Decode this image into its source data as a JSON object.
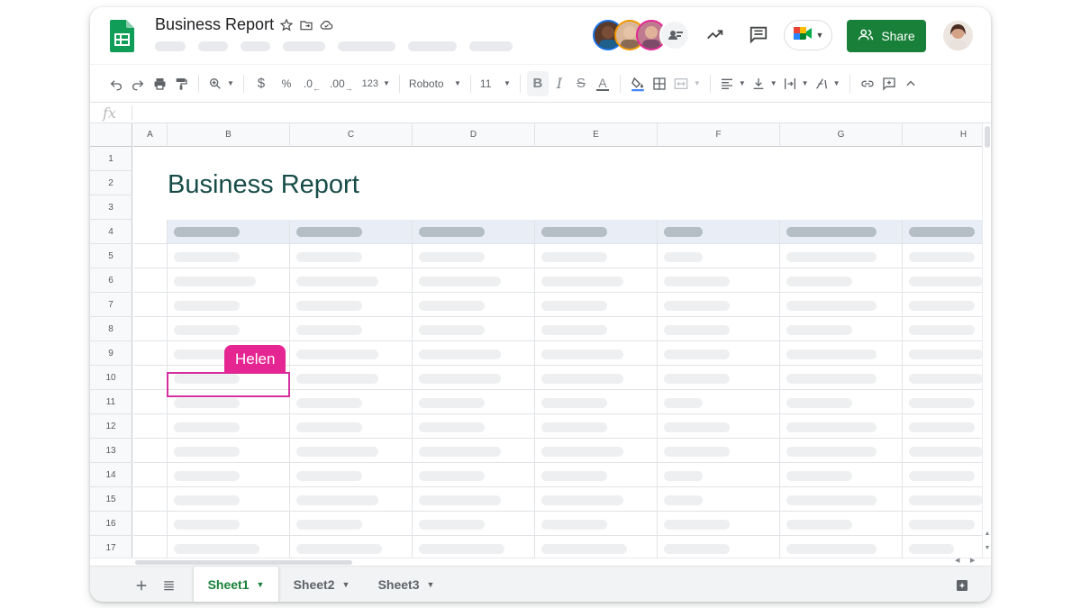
{
  "app": {
    "title": "Business Report"
  },
  "menu": {
    "items_count_visual": [
      "",
      "",
      "",
      "",
      "",
      "",
      ""
    ]
  },
  "toolbar": {
    "currency_label": "$",
    "percent_label": "%",
    "decrease_decimal_label": ".0",
    "increase_decimal_label": ".00",
    "number_format_label": "123",
    "font_family": "Roboto",
    "font_size": "11",
    "bold_label": "B",
    "italic_label": "I",
    "strikethrough_label": "S",
    "text_color_label": "A"
  },
  "formula_bar": {
    "fx_label": "fx",
    "value": ""
  },
  "sheet": {
    "title_cell": "Business Report",
    "columns": [
      "A",
      "B",
      "C",
      "D",
      "E",
      "F",
      "G",
      "H"
    ],
    "rows": [
      "1",
      "2",
      "3",
      "4",
      "5",
      "6",
      "7",
      "8",
      "9",
      "10",
      "11",
      "12",
      "13",
      "14",
      "15",
      "16",
      "17"
    ]
  },
  "collaborator_cursor": {
    "name": "Helen",
    "color": "#e52592"
  },
  "share": {
    "label": "Share",
    "color": "#188038"
  },
  "tabs": [
    {
      "label": "Sheet1",
      "active": true
    },
    {
      "label": "Sheet2",
      "active": false
    },
    {
      "label": "Sheet3",
      "active": false
    }
  ],
  "colors": {
    "accent_green": "#188038",
    "cursor_pink": "#e52592",
    "title_teal": "#174c48",
    "header_row_fill": "#e8edf6"
  }
}
